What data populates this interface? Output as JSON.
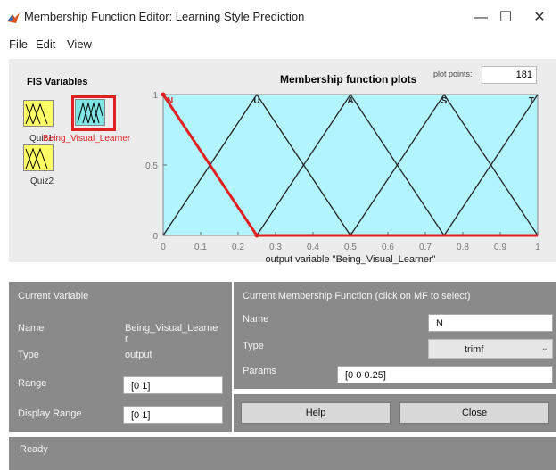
{
  "window": {
    "title": "Membership Function Editor: Learning Style Prediction",
    "minimize": "—",
    "maximize": "☐",
    "close": "✕"
  },
  "menu": {
    "file": "File",
    "edit": "Edit",
    "view": "View"
  },
  "fis": {
    "title": "FIS Variables",
    "input1_label": "Quiz1",
    "output_label": "Being_Visual_Learner",
    "input2_label": "Quiz2"
  },
  "plot": {
    "title": "Membership function plots",
    "plot_points_label": "plot points:",
    "plot_points_value": "181",
    "xlabel": "output variable \"Being_Visual_Learner\""
  },
  "chart_data": {
    "type": "line",
    "xlim": [
      0,
      1
    ],
    "ylim": [
      0,
      1
    ],
    "x_ticks": [
      "0",
      "0.1",
      "0.2",
      "0.3",
      "0.4",
      "0.5",
      "0.6",
      "0.7",
      "0.8",
      "0.9",
      "1"
    ],
    "y_ticks": [
      "0",
      "0.5",
      "1"
    ],
    "selected_series": "N",
    "series": [
      {
        "name": "N",
        "points": [
          [
            0,
            1
          ],
          [
            0.25,
            0
          ]
        ]
      },
      {
        "name": "U",
        "points": [
          [
            0,
            0
          ],
          [
            0.25,
            1
          ],
          [
            0.5,
            0
          ]
        ]
      },
      {
        "name": "A",
        "points": [
          [
            0.25,
            0
          ],
          [
            0.5,
            1
          ],
          [
            0.75,
            0
          ]
        ]
      },
      {
        "name": "S",
        "points": [
          [
            0.5,
            0
          ],
          [
            0.75,
            1
          ],
          [
            1,
            0
          ]
        ]
      },
      {
        "name": "T",
        "points": [
          [
            0.75,
            0
          ],
          [
            1,
            1
          ]
        ]
      }
    ],
    "peak_labels": [
      {
        "name": "N",
        "x": 0
      },
      {
        "name": "U",
        "x": 0.25
      },
      {
        "name": "A",
        "x": 0.5
      },
      {
        "name": "S",
        "x": 0.75
      },
      {
        "name": "T",
        "x": 1
      }
    ]
  },
  "current_variable": {
    "heading": "Current Variable",
    "name_label": "Name",
    "name_value": "Being_Visual_Learne",
    "name_value_wrap": "r",
    "type_label": "Type",
    "type_value": "output",
    "range_label": "Range",
    "range_value": "[0 1]",
    "display_range_label": "Display Range",
    "display_range_value": "[0 1]"
  },
  "current_mf": {
    "heading": "Current Membership Function (click on MF to select)",
    "name_label": "Name",
    "name_value": "N",
    "type_label": "Type",
    "type_value": "trimf",
    "params_label": "Params",
    "params_value": "[0 0 0.25]"
  },
  "buttons": {
    "help": "Help",
    "close": "Close"
  },
  "status": {
    "text": "Ready"
  },
  "colors": {
    "plot_bg": "#b3f5ff",
    "selected_mf": "#e02020",
    "mf_line": "#222222",
    "panel": "#8a8a8a"
  }
}
